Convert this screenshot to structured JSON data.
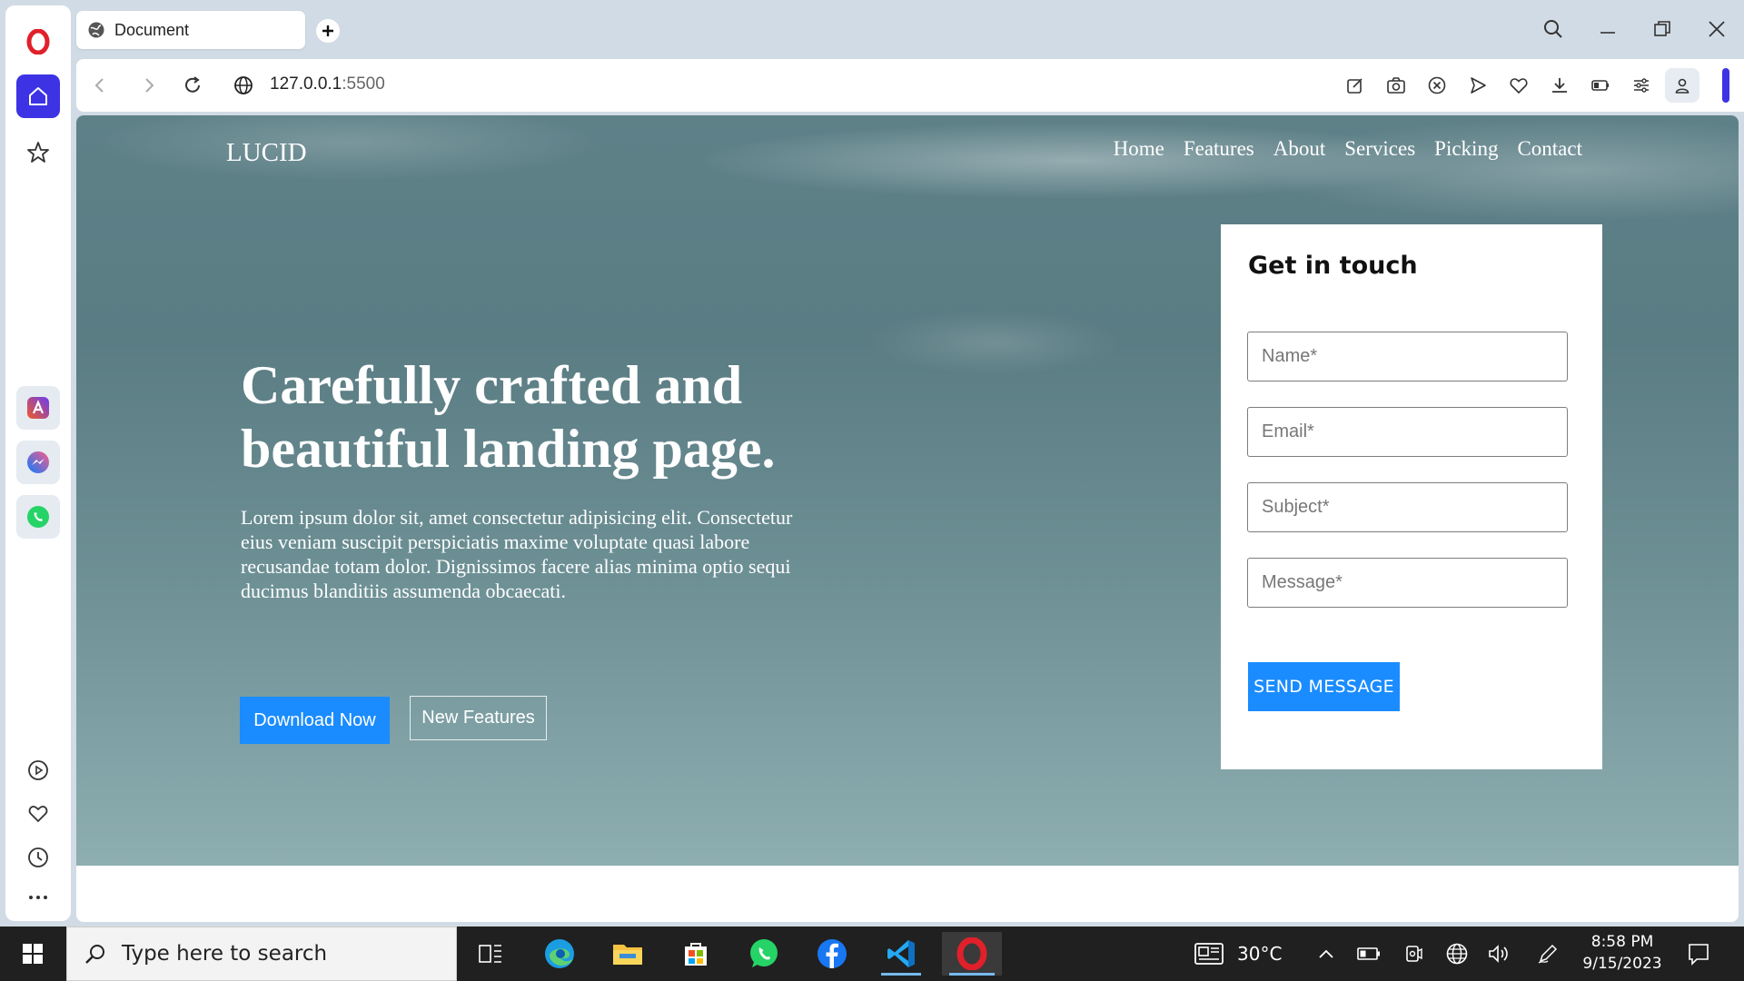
{
  "browser": {
    "tab_title": "Document",
    "url_host": "127.0.0.1",
    "url_port": ":5500"
  },
  "page": {
    "logo": "LUCID",
    "nav": [
      "Home",
      "Features",
      "About",
      "Services",
      "Picking",
      "Contact"
    ],
    "headline_line1": "Carefully crafted and",
    "headline_line2": "beautiful landing page.",
    "lead": "Lorem ipsum dolor sit, amet consectetur adipisicing elit. Consectetur eius veniam suscipit perspiciatis maxime voluptate quasi labore recusandae totam dolor. Dignissimos facere alias minima optio sequi ducimus blanditiis assumenda obcaecati.",
    "download_button": "Download Now",
    "features_button": "New Features",
    "form": {
      "title": "Get in touch",
      "name_placeholder": "Name*",
      "email_placeholder": "Email*",
      "subject_placeholder": "Subject*",
      "message_placeholder": "Message*",
      "send_button": "SEND MESSAGE"
    }
  },
  "taskbar": {
    "search_placeholder": "Type here to search",
    "weather": "30°C",
    "time": "8:58 PM",
    "date": "9/15/2023"
  },
  "colors": {
    "accent_blue": "#1a8cff",
    "opera_red": "#e0202a",
    "sidebar_accent": "#3d33e4"
  }
}
